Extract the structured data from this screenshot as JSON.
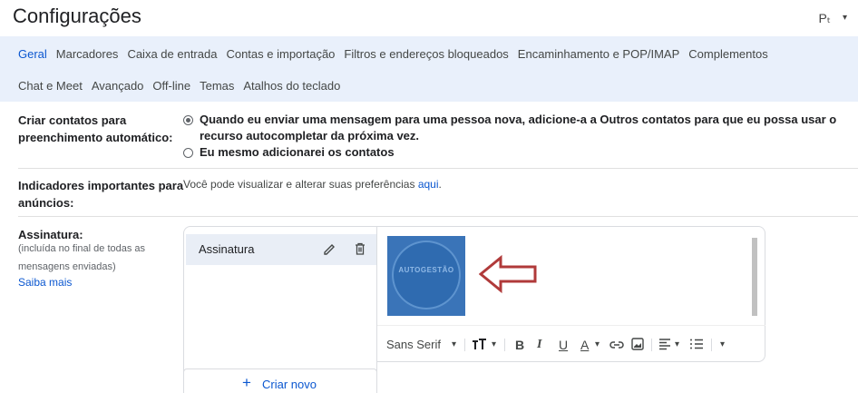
{
  "header": {
    "title": "Configurações",
    "lang_button": "Pₜ",
    "lang_arrow": "▾"
  },
  "tabs": {
    "row1": [
      "Geral",
      "Marcadores",
      "Caixa de entrada",
      "Contas e importação",
      "Filtros e endereços bloqueados",
      "Encaminhamento e POP/IMAP",
      "Complementos"
    ],
    "row2": [
      "Chat e Meet",
      "Avançado",
      "Off-line",
      "Temas",
      "Atalhos do teclado"
    ],
    "active": "Geral"
  },
  "contacts": {
    "label_line1": "Criar contatos para",
    "label_line2": "preenchimento automático:",
    "option1_line1": "Quando eu enviar uma mensagem para uma pessoa nova, adicione-a a Outros contatos para que eu possa usar o",
    "option1_line2": "recurso autocompletar da próxima vez.",
    "option2": "Eu mesmo adicionarei os contatos",
    "selected": 1
  },
  "indicators": {
    "label_line1": "Indicadores importantes para",
    "label_line2": "anúncios:",
    "text": "Você pode visualizar e alterar suas preferências",
    "link": "aqui",
    "period": "."
  },
  "signature": {
    "label": "Assinatura:",
    "hint_line1": "(incluída no final de todas as",
    "hint_line2": "mensagens enviadas)",
    "learn_more": "Saiba mais",
    "items": [
      {
        "name": "Assinatura"
      }
    ],
    "logo_text": "AUTOGESTÃO",
    "create_new": "Criar novo",
    "create_icon": "+"
  },
  "toolbar": {
    "font": "Sans Serif",
    "dropdown": "▾",
    "bold": "B",
    "italic": "I",
    "underline": "U",
    "text_color": "A"
  },
  "colors": {
    "accent": "#0b57d0",
    "tab_bg": "#e9f0fb",
    "arrow": "#b03a3a"
  }
}
